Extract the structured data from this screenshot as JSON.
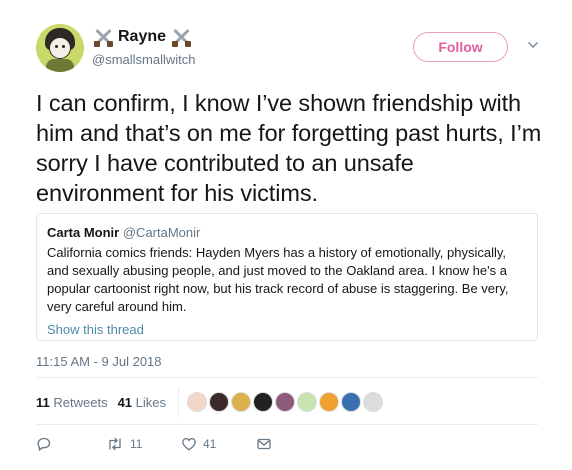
{
  "author": {
    "display_name": "Rayne",
    "handle": "@smallsmallwitch",
    "avatar": "cartoon-avatar",
    "name_emoji": "crossed-swords-icon"
  },
  "follow_label": "Follow",
  "tweet_text": "I can confirm, I know I’ve shown friendship with him and that’s on me for forgetting past hurts, I’m sorry I have contributed to an unsafe environment for his victims.",
  "quote": {
    "name": "Carta Monir",
    "handle": "@CartaMonir",
    "text": "California comics friends: Hayden Myers has a history of emotionally, physically, and sexually abusing people, and just moved to the Oakland area. I know he's a popular cartoonist right now, but his track record of abuse is staggering. Be very, very careful around him.",
    "thread_link": "Show this thread"
  },
  "timestamp": "11:15 AM - 9 Jul 2018",
  "stats": {
    "retweets_count": "11",
    "retweets_label": "Retweets",
    "likes_count": "41",
    "likes_label": "Likes"
  },
  "likers": [
    "#f2d6c9",
    "#3a2a2a",
    "#d9b24c",
    "#222222",
    "#8c5a7a",
    "#c7e3b0",
    "#f0a030",
    "#3a6fb0",
    "#dcdcdc"
  ],
  "actions": {
    "reply_count": "",
    "retweet_count": "11",
    "like_count": "41"
  },
  "colors": {
    "accent_pink": "#e0609a",
    "link": "#4f8aa8",
    "muted": "#657786"
  }
}
